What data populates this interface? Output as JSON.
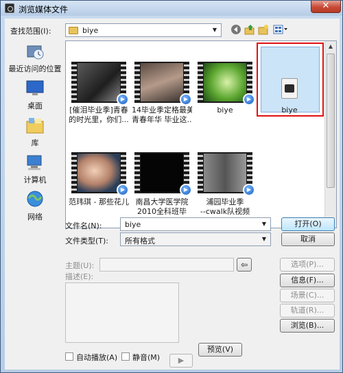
{
  "window": {
    "title": "浏览媒体文件",
    "close_label": "✕"
  },
  "toolbar": {
    "lookin_label": "查找范围(I):",
    "lookin_value": "biye",
    "back_icon": "back-arrow",
    "up_icon": "up-folder",
    "new_folder_icon": "new-folder",
    "view_icon": "view-menu"
  },
  "places": [
    {
      "label": "最近访问的位置",
      "icon": "recent-places-icon"
    },
    {
      "label": "桌面",
      "icon": "desktop-icon"
    },
    {
      "label": "库",
      "icon": "libraries-icon"
    },
    {
      "label": "计算机",
      "icon": "computer-icon"
    },
    {
      "label": "网络",
      "icon": "network-icon"
    }
  ],
  "files": [
    {
      "line1": "[催泪毕业季]青春",
      "line2": "的时光里，你们..."
    },
    {
      "line1": "14毕业季定格最美",
      "line2": "青春年华 毕业这..."
    },
    {
      "line1": "biye",
      "line2": ""
    },
    {
      "line1": "biye",
      "line2": ""
    },
    {
      "line1": "范玮琪 - 那些花儿",
      "line2": ""
    },
    {
      "line1": "南昌大学医学院",
      "line2": "2010全科班毕"
    },
    {
      "line1": "浦园毕业季",
      "line2": "--cwalk队视频"
    }
  ],
  "form": {
    "filename_label": "文件名(N):",
    "filename_value": "biye",
    "filetype_label": "文件类型(T):",
    "filetype_value": "所有格式",
    "open_button": "打开(O)",
    "cancel_button": "取消"
  },
  "metadata": {
    "subject_label": "主题(U):",
    "description_label": "描述(E):",
    "options_button": "选项(P)...",
    "info_button": "信息(F)...",
    "scenes_button": "场景(C)...",
    "tracks_button": "轨道(R)...",
    "browse_button": "浏览(B)...",
    "autoplay_label": "自动播放(A)",
    "mute_label": "静音(M)",
    "preview_button": "预览(V)",
    "play_label": "▶"
  },
  "colors": {
    "selection": "#cce4f7",
    "highlight": "#e01010",
    "titlebar": "#b6cce6"
  }
}
